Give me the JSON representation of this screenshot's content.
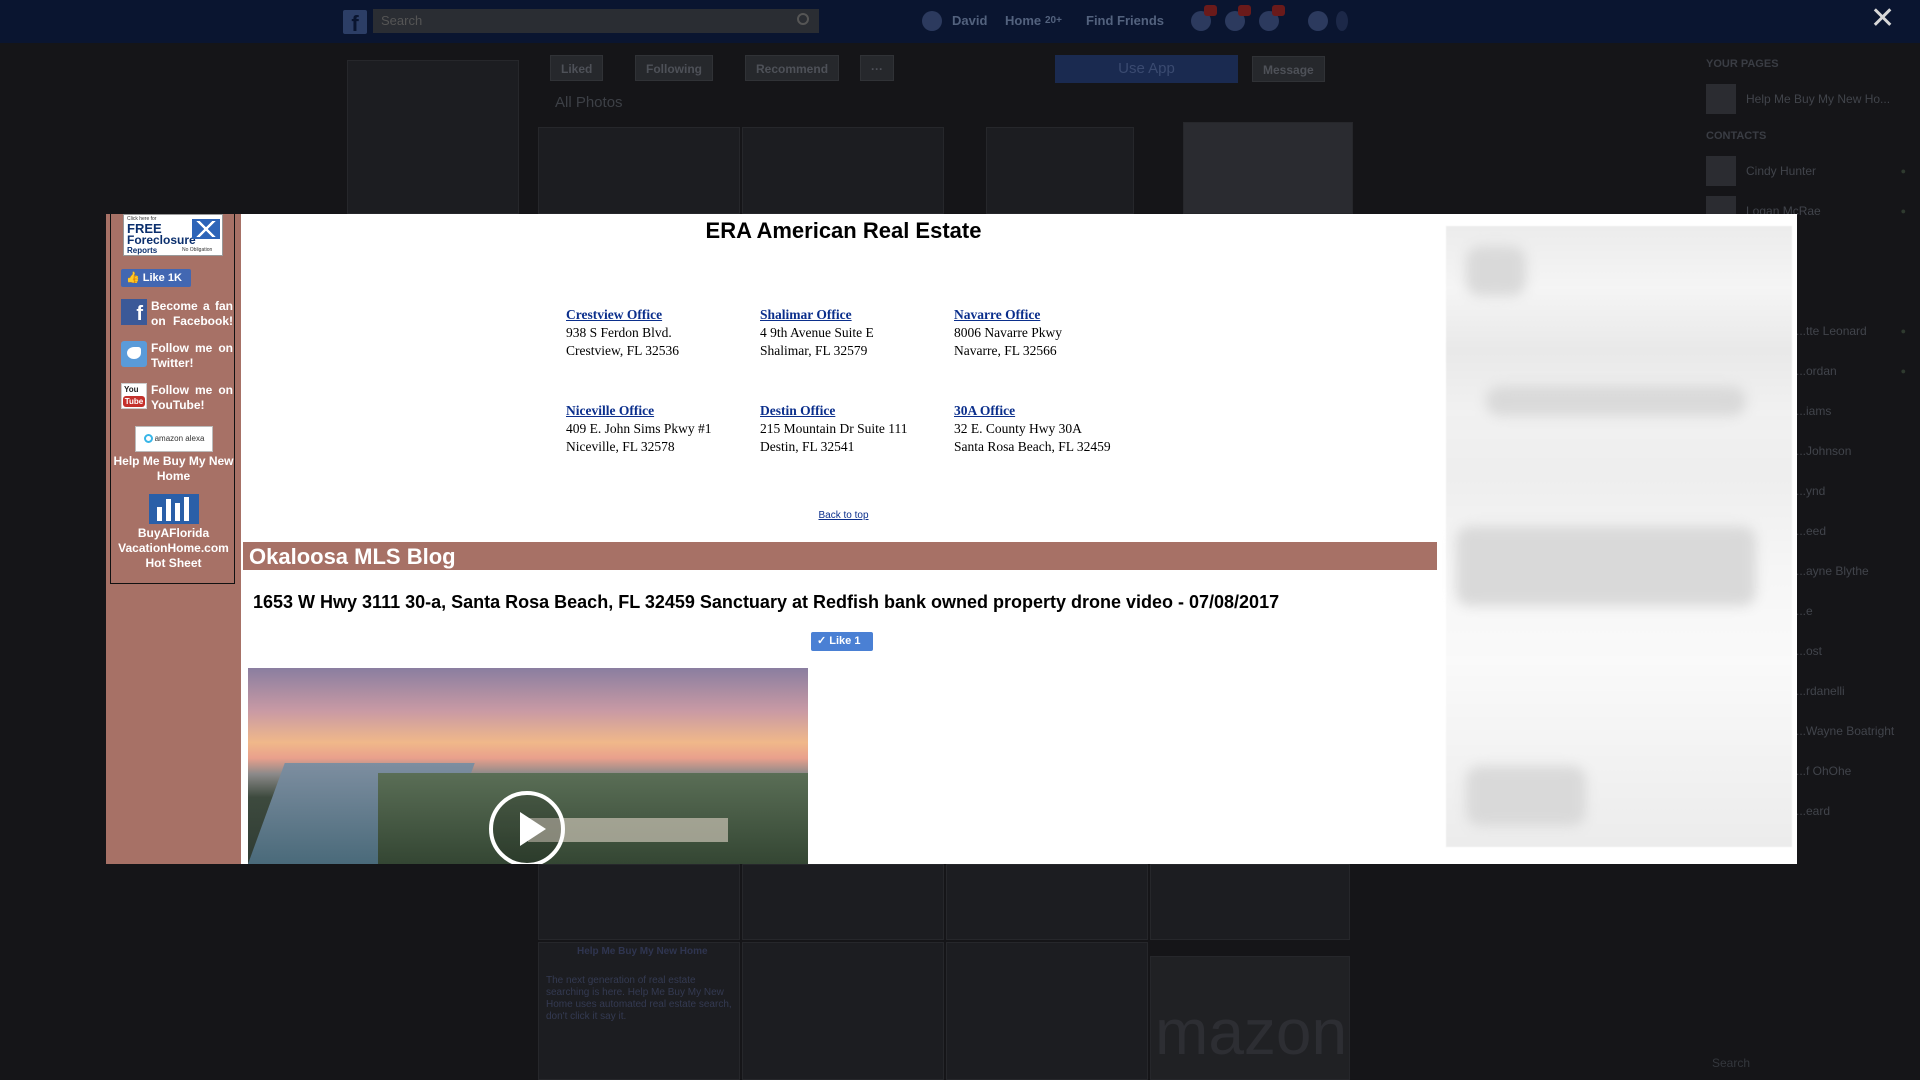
{
  "facebook": {
    "search_placeholder": "Search",
    "nav": {
      "user": "David",
      "home": "Home",
      "home_count": "20+",
      "find_friends": "Find Friends"
    },
    "page_buttons": {
      "liked": "Liked",
      "following": "Following",
      "recommend": "Recommend",
      "more": "···"
    },
    "use_app": "Use App",
    "message": "Message",
    "all_photos": "All Photos",
    "your_pages_heading": "YOUR PAGES",
    "your_page_name": "Help Me Buy My New Ho...",
    "contacts_heading": "CONTACTS",
    "contacts": [
      "Cindy Hunter",
      "Logan McRae",
      "",
      "",
      "...tte Leonard",
      "...ordan",
      "...iams",
      "...Johnson",
      "...ynd",
      "...eed",
      "...ayne Blythe",
      "...e",
      "...ost",
      "...rdanelli",
      "...Wayne Boatright",
      "...f OhOhe",
      "...eard"
    ],
    "post_title": "Help Me Buy My New Home",
    "post_text": "The next generation of real estate searching is here. Help Me Buy My New Home uses automated real estate search, don't click it say it.",
    "bottom_search": "Search",
    "amazon_text": "mazon"
  },
  "modal": {
    "close_label": "✕",
    "sidebar": {
      "foreclosure": {
        "small": "Click here for",
        "free": "FREE",
        "foreclosure": "Foreclosure",
        "reports": "Reports",
        "no_obligation": "No Obligation"
      },
      "like_label": "Like 1K",
      "facebook_text": "Become a fan on Facebook!",
      "twitter_text": "Follow me on Twitter!",
      "youtube_text": "Follow me on YouTube!",
      "youtube_icon_top": "You",
      "youtube_icon_bottom": "Tube",
      "alexa_label": "amazon alexa",
      "alexa_caption": "Help Me Buy My New Home",
      "hotsheet_caption": "BuyAFlorida VacationHome.com Hot Sheet"
    },
    "content": {
      "title": "ERA American Real Estate",
      "offices": [
        {
          "name": "Crestview Office",
          "line1": "938 S Ferdon Blvd.",
          "line2": "Crestview, FL 32536"
        },
        {
          "name": "Shalimar Office",
          "line1": "4 9th Avenue Suite E",
          "line2": "Shalimar, FL 32579"
        },
        {
          "name": "Navarre Office",
          "line1": "8006 Navarre Pkwy",
          "line2": "Navarre, FL 32566"
        },
        {
          "name": "Niceville Office",
          "line1": "409 E. John Sims Pkwy #1",
          "line2": "Niceville, FL 32578"
        },
        {
          "name": "Destin Office",
          "line1": "215 Mountain Dr Suite 111",
          "line2": "Destin, FL 32541"
        },
        {
          "name": "30A Office",
          "line1": "32 E. County Hwy 30A",
          "line2": "Santa Rosa Beach, FL 32459"
        }
      ],
      "back_to_top": "Back to top",
      "blog_title": "Okaloosa MLS Blog",
      "post_title": "1653 W Hwy 3111 30-a, Santa Rosa Beach, FL 32459 Sanctuary at Redfish bank owned property drone video - 07/08/2017",
      "post_like": "Like 1"
    }
  },
  "colors": {
    "sidebar": "#a77166",
    "link": "#0b2f8c",
    "facebook_blue": "#4267b2",
    "overlay_dark": "#151518"
  }
}
